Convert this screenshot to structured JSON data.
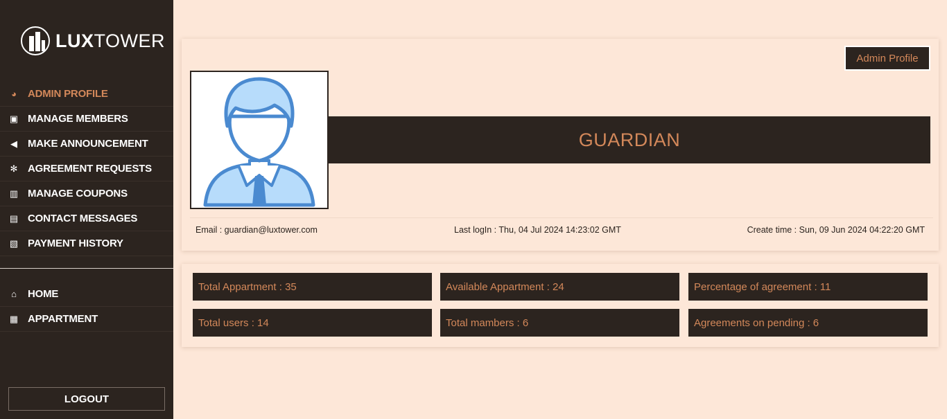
{
  "sidebar": {
    "logo": {
      "bold": "LUX",
      "light": "TOWER"
    },
    "nav_top": [
      {
        "label": "ADMIN PROFILE",
        "icon": "admin-icon",
        "glyph": "◕",
        "active": true
      },
      {
        "label": "MANAGE MEMBERS",
        "icon": "id-card-icon",
        "glyph": "▣",
        "active": false
      },
      {
        "label": "MAKE ANNOUNCEMENT",
        "icon": "megaphone-icon",
        "glyph": "◀",
        "active": false
      },
      {
        "label": "AGREEMENT REQUESTS",
        "icon": "asterisk-icon",
        "glyph": "✻",
        "active": false
      },
      {
        "label": "MANAGE COUPONS",
        "icon": "ticket-icon",
        "glyph": "▥",
        "active": false
      },
      {
        "label": "CONTACT MESSAGES",
        "icon": "contact-icon",
        "glyph": "▤",
        "active": false
      },
      {
        "label": "PAYMENT HISTORY",
        "icon": "receipt-icon",
        "glyph": "▧",
        "active": false
      }
    ],
    "nav_bottom": [
      {
        "label": "HOME",
        "icon": "home-icon",
        "glyph": "⌂"
      },
      {
        "label": "APPARTMENT",
        "icon": "map-icon",
        "glyph": "▦"
      }
    ],
    "logout_label": "LOGOUT"
  },
  "profile": {
    "admin_button": "Admin Profile",
    "name": "GUARDIAN",
    "email": "Email : guardian@luxtower.com",
    "last_login": "Last logIn : Thu, 04 Jul 2024 14:23:02 GMT",
    "create_time": "Create time : Sun, 09 Jun 2024 04:22:20 GMT"
  },
  "stats": [
    "Total Appartment : 35",
    "Available Appartment : 24",
    "Percentage of agreement : 11",
    "Total users : 14",
    "Total mambers : 6",
    "Agreements on pending : 6"
  ],
  "colors": {
    "dark": "#2c241f",
    "accent": "#d3885a",
    "background": "#fde7d8",
    "avatar_blue": "#4a8ad0",
    "avatar_light": "#b7dcfb"
  }
}
